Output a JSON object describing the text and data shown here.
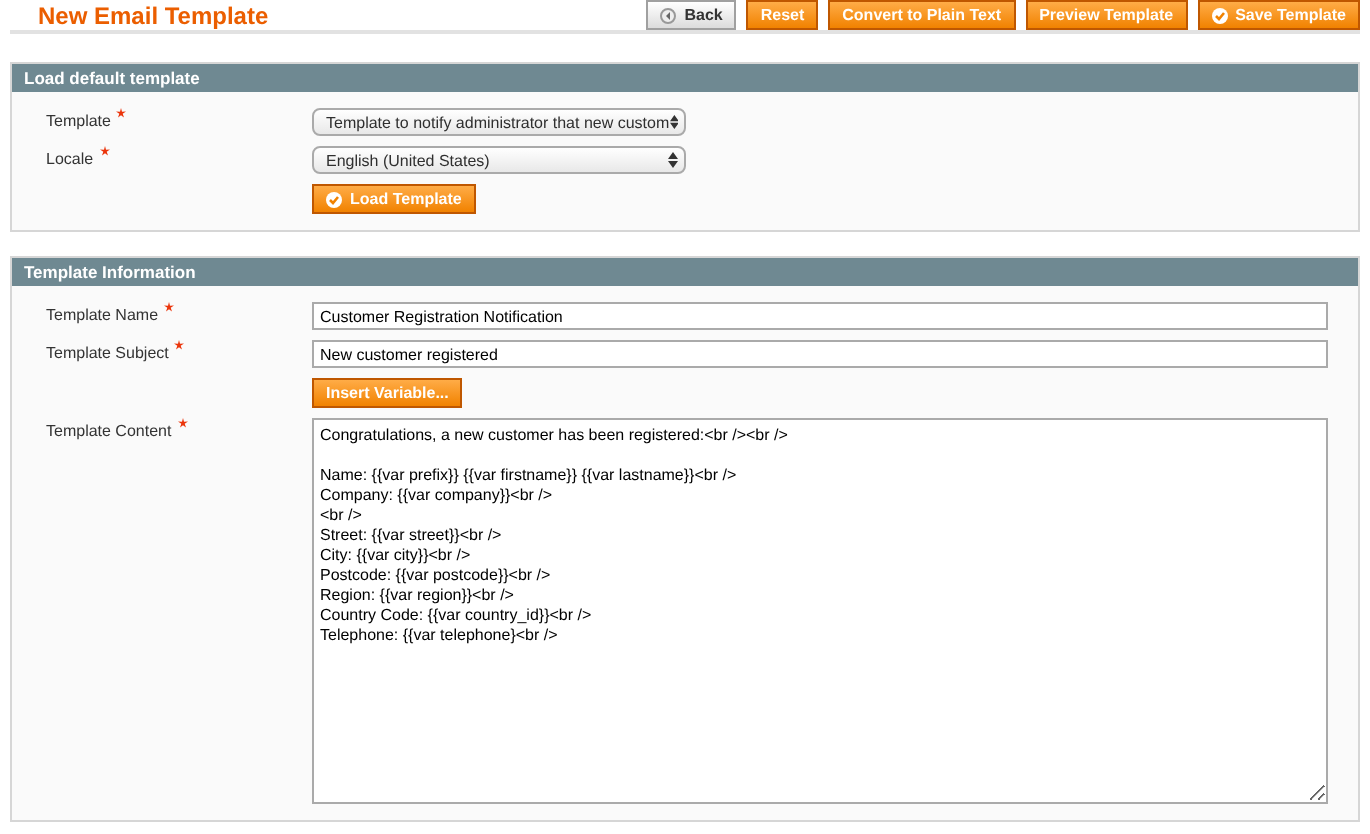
{
  "page_title": "New Email Template",
  "buttons": [
    {
      "label": "Back",
      "kind": "back"
    },
    {
      "label": "Reset",
      "kind": "plain"
    },
    {
      "label": "Convert to Plain Text",
      "kind": "plain"
    },
    {
      "label": "Preview Template",
      "kind": "plain"
    },
    {
      "label": "Save Template",
      "kind": "save"
    }
  ],
  "load_section": {
    "title": "Load default template",
    "fields": [
      {
        "label": "Template",
        "required": true,
        "value": "Template to notify administrator that new custom"
      },
      {
        "label": "Locale",
        "required": true,
        "value": "English (United States)"
      }
    ],
    "button": "Load Template"
  },
  "info_section": {
    "title": "Template Information",
    "name": {
      "label": "Template Name",
      "required": true,
      "value": "Customer Registration Notification"
    },
    "subject": {
      "label": "Template Subject",
      "required": true,
      "value": "New customer registered"
    },
    "insert_button": "Insert Variable...",
    "content": {
      "label": "Template Content",
      "required": true,
      "value": "Congratulations, a new customer has been registered:<br /><br />\n\nName: {{var prefix}} {{var firstname}} {{var lastname}}<br />\nCompany: {{var company}}<br />\n<br />\nStreet: {{var street}}<br />\nCity: {{var city}}<br />\nPostcode: {{var postcode}}<br />\nRegion: {{var region}}<br />\nCountry Code: {{var country_id}}<br />\nTelephone: {{var telephone}<br />"
    }
  }
}
